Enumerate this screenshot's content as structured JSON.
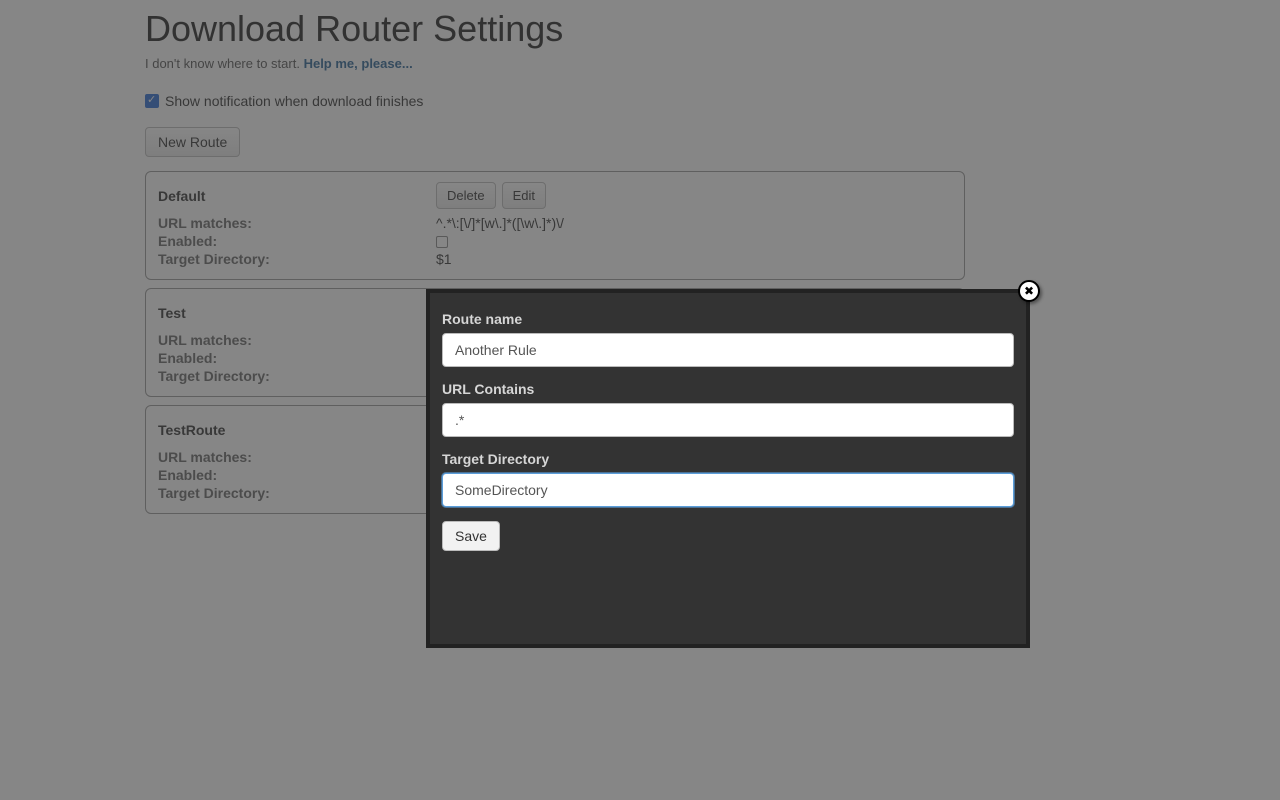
{
  "header": {
    "title": "Download Router Settings",
    "intro_text": "I don't know where to start.",
    "intro_link": "Help me, please..."
  },
  "notify": {
    "label": "Show notification when download finishes",
    "checked": true
  },
  "new_route_btn": "New Route",
  "field_labels": {
    "url_matches": "URL matches:",
    "enabled": "Enabled:",
    "target_dir": "Target Directory:"
  },
  "action_labels": {
    "delete": "Delete",
    "edit": "Edit"
  },
  "routes": [
    {
      "name": "Default",
      "url": "^.*\\:[\\/]*[w\\.]*([\\w\\.]*)\\/",
      "enabled": false,
      "target": "$1"
    },
    {
      "name": "Test",
      "url": "",
      "enabled": null,
      "target": ""
    },
    {
      "name": "TestRoute",
      "url": "",
      "enabled": null,
      "target": ""
    }
  ],
  "modal": {
    "route_name_label": "Route name",
    "route_name_value": "Another Rule",
    "url_contains_label": "URL Contains",
    "url_contains_value": ".*",
    "target_dir_label": "Target Directory",
    "target_dir_value": "SomeDirectory",
    "save_label": "Save"
  }
}
